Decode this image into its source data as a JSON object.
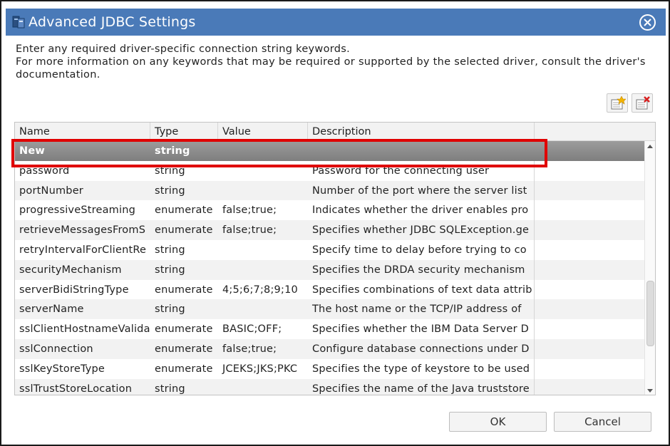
{
  "window": {
    "title": "Advanced JDBC Settings"
  },
  "description": {
    "line1": "Enter any required driver-specific connection string keywords.",
    "line2": "For more information on any keywords that may be required or supported by the selected driver, consult the driver's documentation."
  },
  "toolbar": {
    "add_icon": "add-row-icon",
    "delete_icon": "delete-row-icon"
  },
  "table": {
    "columns": [
      "Name",
      "Type",
      "Value",
      "Description"
    ],
    "rows": [
      {
        "name": "New",
        "type": "string",
        "value": "",
        "description": ""
      },
      {
        "name": "password",
        "type": "string",
        "value": "",
        "description": "Password for the connecting user"
      },
      {
        "name": "portNumber",
        "type": "string",
        "value": "",
        "description": "Number of the port where the server list"
      },
      {
        "name": "progressiveStreaming",
        "type": "enumerate",
        "value": "false;true;",
        "description": "Indicates whether the driver enables pro"
      },
      {
        "name": "retrieveMessagesFromS",
        "type": "enumerate",
        "value": "false;true;",
        "description": "Specifies whether JDBC SQLException.ge"
      },
      {
        "name": "retryIntervalForClientRe",
        "type": "string",
        "value": "",
        "description": "Specify time to delay before trying to co"
      },
      {
        "name": "securityMechanism",
        "type": "string",
        "value": "",
        "description": "Specifies the DRDA security mechanism"
      },
      {
        "name": "serverBidiStringType",
        "type": "enumerate",
        "value": "4;5;6;7;8;9;10",
        "description": "Specifies combinations of text data attrib"
      },
      {
        "name": "serverName",
        "type": "string",
        "value": "",
        "description": "The host name or the TCP/IP address of"
      },
      {
        "name": "sslClientHostnameValida",
        "type": "enumerate",
        "value": "BASIC;OFF;",
        "description": "Specifies whether the IBM Data Server D"
      },
      {
        "name": "sslConnection",
        "type": "enumerate",
        "value": "false;true;",
        "description": "Configure database connections under D"
      },
      {
        "name": "sslKeyStoreType",
        "type": "enumerate",
        "value": "JCEKS;JKS;PKC",
        "description": "Specifies the type of keystore to be used"
      },
      {
        "name": "sslTrustStoreLocation",
        "type": "string",
        "value": "",
        "description": "Specifies the name of the Java truststore"
      }
    ]
  },
  "buttons": {
    "ok": "OK",
    "cancel": "Cancel"
  },
  "colors": {
    "titlebar": "#4a7ab8",
    "selected_row": "#8a8a8a",
    "highlight_box": "#e00000"
  }
}
